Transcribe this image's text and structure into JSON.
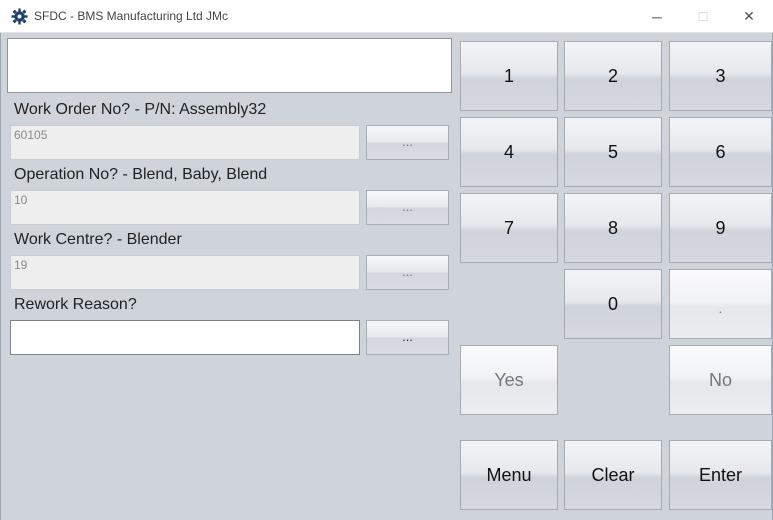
{
  "window": {
    "title": "SFDC - BMS Manufacturing Ltd JMc",
    "minimize_glyph": "─",
    "maximize_glyph": "☐",
    "close_glyph": "✕",
    "icon": "gear-app-icon"
  },
  "message": "",
  "fields": {
    "work_order": {
      "label": "Work Order No? - P/N: Assembly32",
      "value": "60105",
      "lookup_label": "..."
    },
    "operation": {
      "label": "Operation No? - Blend, Baby, Blend",
      "value": "10",
      "lookup_label": "..."
    },
    "work_centre": {
      "label": "Work Centre? - Blender",
      "value": "19",
      "lookup_label": "..."
    },
    "rework_reason": {
      "label": "Rework Reason?",
      "value": "",
      "lookup_label": "..."
    }
  },
  "keypad": {
    "k1": "1",
    "k2": "2",
    "k3": "3",
    "k4": "4",
    "k5": "5",
    "k6": "6",
    "k7": "7",
    "k8": "8",
    "k9": "9",
    "k0": "0",
    "dot": ".",
    "yes": "Yes",
    "no": "No",
    "menu": "Menu",
    "clear": "Clear",
    "enter": "Enter"
  }
}
